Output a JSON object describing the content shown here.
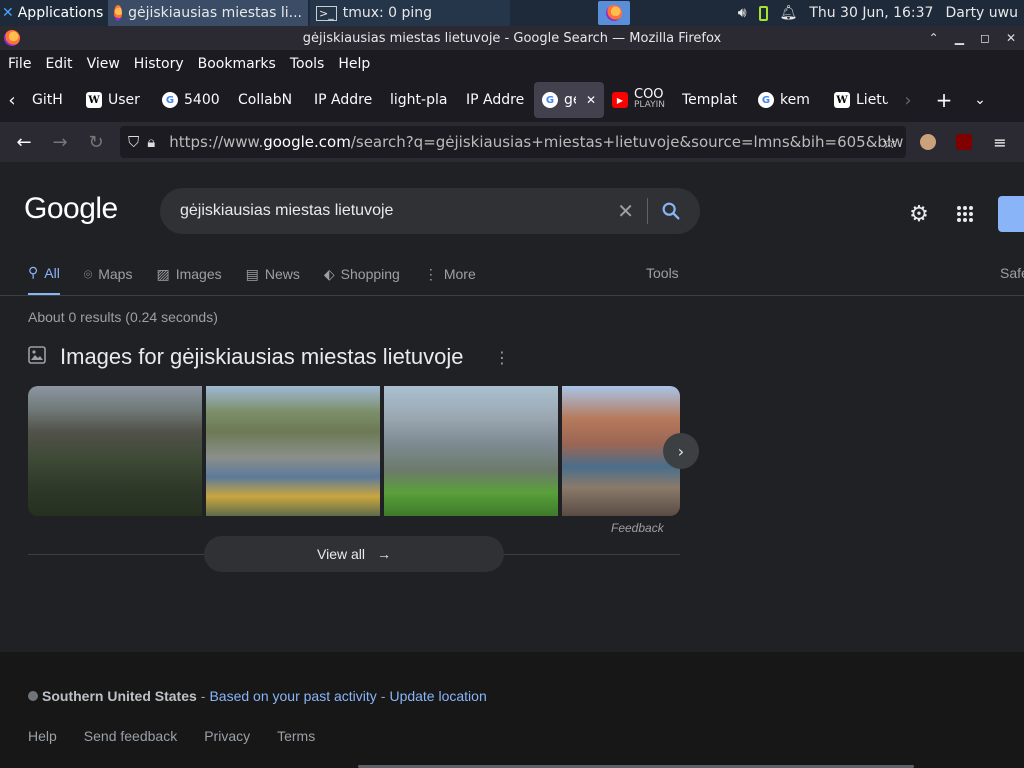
{
  "taskbar": {
    "apps_label": "Applications",
    "tasks": [
      "gėjiskiausias miestas li...",
      "tmux: 0 ping"
    ],
    "clock": "Thu 30 Jun, 16:37",
    "user": "Darty uwu"
  },
  "window": {
    "title": "gėjiskiausias miestas lietuvoje - Google Search — Mozilla Firefox"
  },
  "menu": [
    "File",
    "Edit",
    "View",
    "History",
    "Bookmarks",
    "Tools",
    "Help"
  ],
  "tabs": [
    {
      "label": "GitH",
      "icon": "github-icon"
    },
    {
      "label": "User",
      "icon": "wikipedia-icon"
    },
    {
      "label": "5400",
      "icon": "google-icon"
    },
    {
      "label": "CollabN",
      "icon": "none"
    },
    {
      "label": "IP Addre",
      "icon": "none"
    },
    {
      "label": "light-pla",
      "icon": "none"
    },
    {
      "label": "IP Addre",
      "icon": "none"
    },
    {
      "label": "gėj",
      "icon": "google-icon",
      "selected": true
    },
    {
      "label": "COO",
      "sublabel": "PLAYIN",
      "icon": "youtube-icon"
    },
    {
      "label": "Templat",
      "icon": "none"
    },
    {
      "label": "kem",
      "icon": "google-icon"
    },
    {
      "label": "Lietu",
      "icon": "wikipedia-icon"
    }
  ],
  "nav": {
    "url_prefix": "https://www.",
    "url_host": "google.com",
    "url_rest": "/search?q=gėjiskiausias+miestas+lietuvoje&source=lmns&bih=605&biw"
  },
  "google": {
    "logo": "Google",
    "query": "gėjiskiausias miestas lietuvoje",
    "search_tabs": [
      "All",
      "Maps",
      "Images",
      "News",
      "Shopping",
      "More"
    ],
    "tools": "Tools",
    "safe": "Safe",
    "stats": "About 0 results (0.24 seconds)",
    "images_title": "Images for gėjiskiausias miestas lietuvoje",
    "feedback": "Feedback",
    "view_all": "View all",
    "location_name": "Southern United States",
    "location_sep1": "-",
    "location_based": "Based on your past activity",
    "location_sep2": "-",
    "location_update": "Update location",
    "footer_links": [
      "Help",
      "Send feedback",
      "Privacy",
      "Terms"
    ]
  },
  "colors": {
    "page_bg": "#202124",
    "link": "#8ab4f8",
    "accent": "#8ab4f8"
  }
}
